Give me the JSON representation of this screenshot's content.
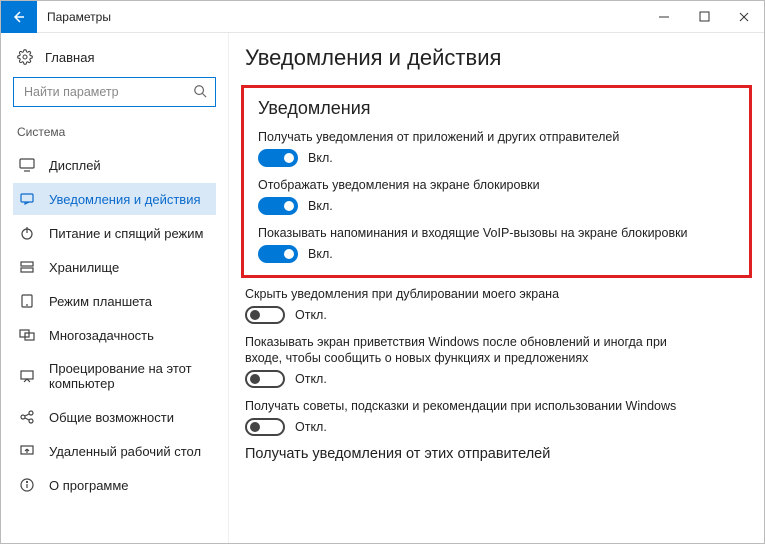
{
  "titlebar": {
    "title": "Параметры"
  },
  "sidebar": {
    "home": "Главная",
    "search_placeholder": "Найти параметр",
    "category": "Система",
    "items": [
      {
        "label": "Дисплей"
      },
      {
        "label": "Уведомления и действия"
      },
      {
        "label": "Питание и спящий режим"
      },
      {
        "label": "Хранилище"
      },
      {
        "label": "Режим планшета"
      },
      {
        "label": "Многозадачность"
      },
      {
        "label": "Проецирование на этот компьютер"
      },
      {
        "label": "Общие возможности"
      },
      {
        "label": "Удаленный рабочий стол"
      },
      {
        "label": "О программе"
      }
    ]
  },
  "content": {
    "page_title": "Уведомления и действия",
    "section_title": "Уведомления",
    "state_on": "Вкл.",
    "state_off": "Откл.",
    "settings": [
      {
        "desc": "Получать уведомления от приложений и других отправителей",
        "on": true
      },
      {
        "desc": "Отображать уведомления на экране блокировки",
        "on": true
      },
      {
        "desc": "Показывать напоминания и входящие VoIP-вызовы на экране блокировки",
        "on": true
      },
      {
        "desc": "Скрыть уведомления при дублировании моего экрана",
        "on": false
      },
      {
        "desc": "Показывать экран приветствия Windows после обновлений и иногда при входе, чтобы сообщить о новых функциях и предложениях",
        "on": false
      },
      {
        "desc": "Получать советы, подсказки и рекомендации при использовании Windows",
        "on": false
      }
    ],
    "sub_heading": "Получать уведомления от этих отправителей"
  }
}
